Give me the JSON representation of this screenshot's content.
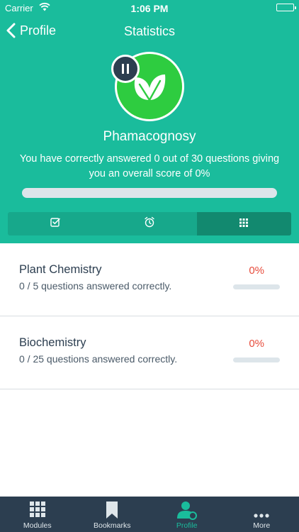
{
  "status_bar": {
    "carrier": "Carrier",
    "time": "1:06 PM"
  },
  "nav": {
    "back_label": "Profile",
    "title": "Statistics"
  },
  "module": {
    "title": "Phamacognosy",
    "score_text": "You have correctly answered 0 out of 30 questions giving you an overall score of 0%",
    "progress_fraction": 0,
    "icon": "leaf-icon",
    "badge_icon": "pause-icon"
  },
  "segments": [
    {
      "icon": "checkbox-icon",
      "active": false
    },
    {
      "icon": "alarm-icon",
      "active": false
    },
    {
      "icon": "grid-icon",
      "active": true
    }
  ],
  "topics": [
    {
      "title": "Plant Chemistry",
      "subtitle": "0 / 5 questions answered correctly.",
      "percent": "0%",
      "progress_fraction": 0
    },
    {
      "title": "Biochemistry",
      "subtitle": "0 / 25 questions answered correctly.",
      "percent": "0%",
      "progress_fraction": 0
    }
  ],
  "tabs": [
    {
      "label": "Modules",
      "icon": "grid-icon",
      "active": false
    },
    {
      "label": "Bookmarks",
      "icon": "bookmark-icon",
      "active": false
    },
    {
      "label": "Profile",
      "icon": "profile-icon",
      "active": true
    },
    {
      "label": "More",
      "icon": "more-icon",
      "active": false
    }
  ],
  "colors": {
    "primary": "#1abc9c",
    "module_icon": "#2ecc40",
    "dark": "#2c3e50",
    "percent": "#e74c3c",
    "progress_track": "#dde5ea"
  }
}
